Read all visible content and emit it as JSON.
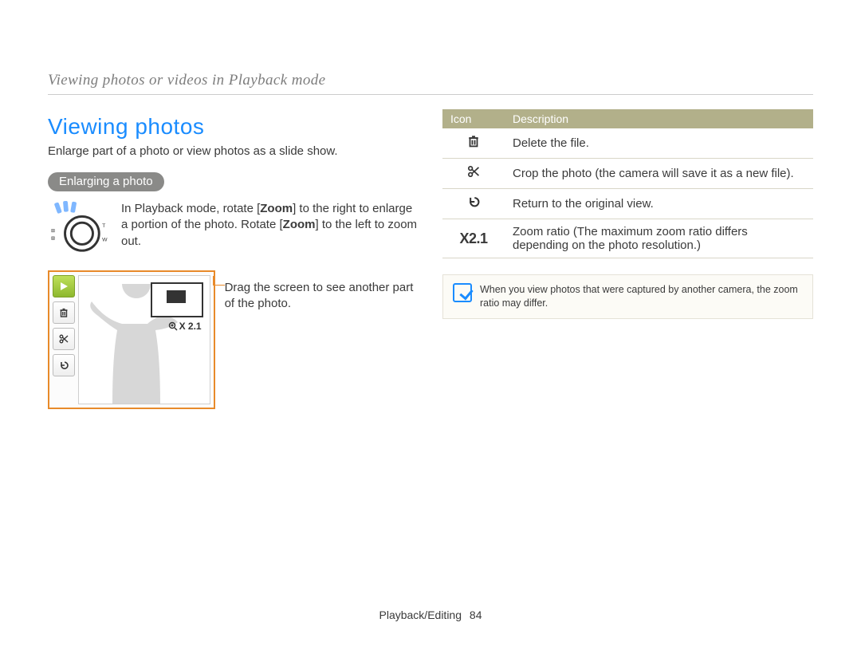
{
  "header": "Viewing photos or videos in Playback mode",
  "left": {
    "title": "Viewing photos",
    "intro": "Enlarge part of a photo or view photos as a slide show.",
    "pill": "Enlarging a photo",
    "zoom_instruction_pre": "In Playback mode, rotate ",
    "zoom_instruction_b1": "Zoom",
    "zoom_instruction_mid": " to the right to enlarge a portion of the photo. Rotate ",
    "zoom_instruction_b2": "Zoom",
    "zoom_instruction_post": " to the left to zoom out.",
    "zoom_badge": "X 2.1",
    "drag_note": "Drag the screen to see another part of the photo."
  },
  "table": {
    "head_icon": "Icon",
    "head_desc": "Description",
    "rows": [
      {
        "icon": "trash",
        "desc": "Delete the file."
      },
      {
        "icon": "scissors",
        "desc": "Crop the photo (the camera will save it as a new file)."
      },
      {
        "icon": "return",
        "desc": "Return to the original view."
      },
      {
        "icon": "x21",
        "label": "X2.1",
        "desc": "Zoom ratio (The maximum zoom ratio differs depending on the photo resolution.)"
      }
    ]
  },
  "note": "When you view photos that were captured by another camera, the zoom ratio may differ.",
  "footer": {
    "chapter": "Playback/Editing",
    "page": "84"
  }
}
